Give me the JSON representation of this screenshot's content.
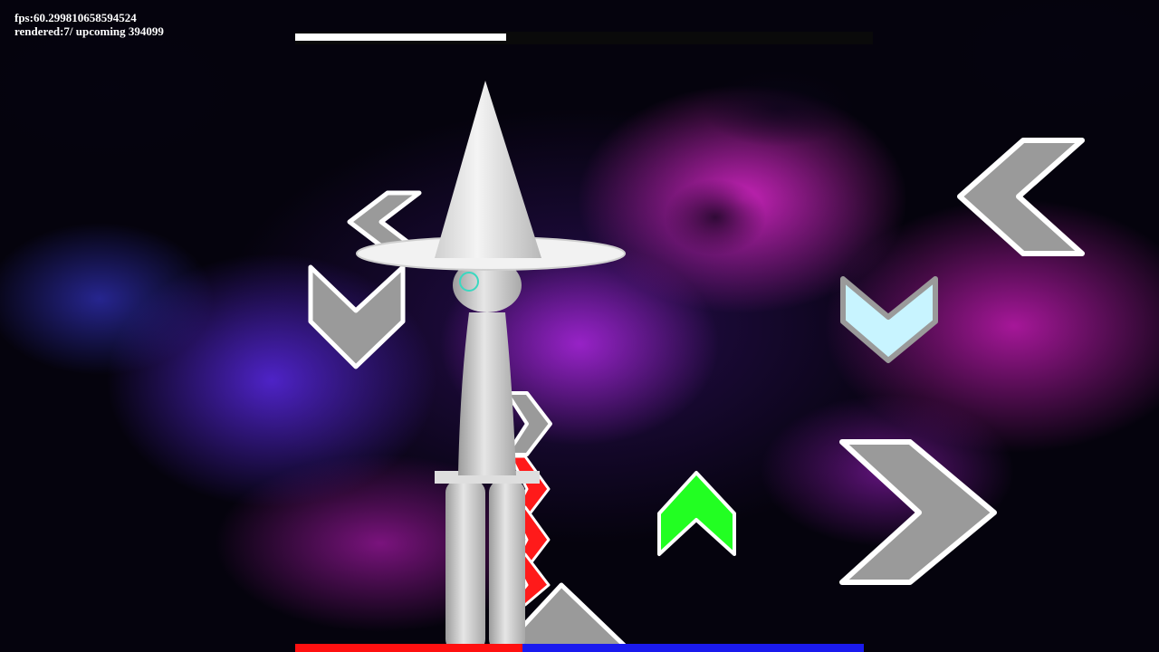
{
  "hud": {
    "fps_text": "fps:60.299810658594524",
    "rendered_text": "rendered:7/ upcoming 394099"
  },
  "song_progress": 0.365,
  "health": {
    "player_share": 0.6,
    "opponent_color": "#ff1010",
    "player_color": "#1a1aee"
  },
  "colors": {
    "receptor_gray": "#9a9a9a",
    "note_red": "#ff1a1a",
    "note_green": "#22ff22",
    "note_lightblue": "#c8f4ff",
    "nebula_magenta": "#e028d2",
    "nebula_violet": "#5a28e6"
  },
  "notes": {
    "player_receptors": [
      "left-arrow",
      "down-arrow",
      "up-arrow",
      "right-arrow"
    ],
    "opponent_receptors": [
      "left-arrow",
      "down-arrow",
      "right-arrow",
      "up-arrow"
    ],
    "scrolling_notes": [
      "red-right-arrow",
      "red-right-arrow",
      "red-right-arrow",
      "red-right-arrow",
      "green-up-arrow"
    ]
  },
  "character": {
    "name": "witch-character",
    "hat": "witch-hat"
  }
}
